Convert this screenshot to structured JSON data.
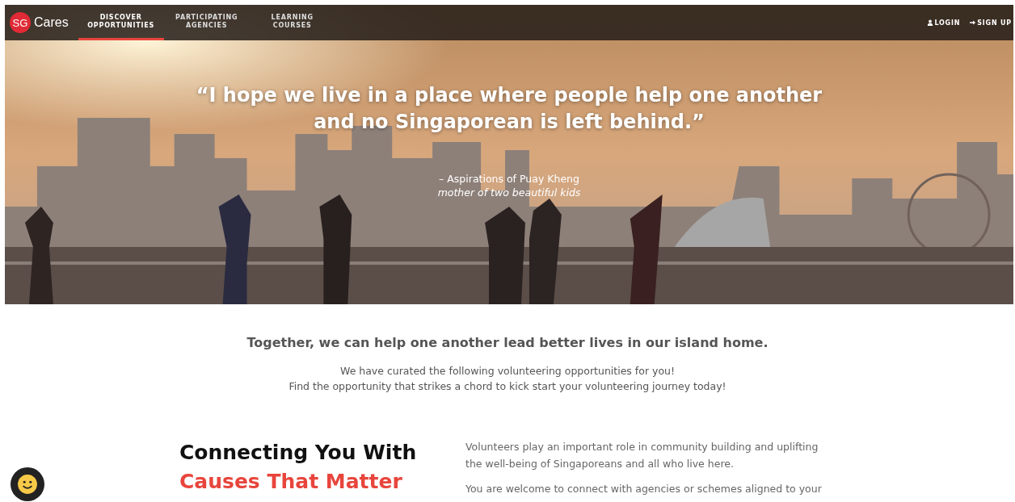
{
  "navbar": {
    "logo": {
      "badge": "SG",
      "name": "Cares"
    },
    "items": [
      {
        "label": "DISCOVER OPPORTUNITIES",
        "selected": true
      },
      {
        "label": "PARTICIPATING AGENCIES",
        "selected": false
      },
      {
        "label": "LEARNING COURSES",
        "selected": false
      }
    ],
    "account": [
      {
        "label": "LOGIN",
        "kind": "login"
      },
      {
        "label": "SIGN UP",
        "kind": "signup"
      }
    ]
  },
  "hero": {
    "quote_line_1": "“I hope we live in a place where people help one another",
    "quote_line_2": "and no Singaporean is left behind.”",
    "attribution": "– Aspirations of Puay Kheng",
    "caption": "mother of two beautiful kids"
  },
  "intro": {
    "heading": "Together, we can help one another lead better lives in our island home.",
    "lines": [
      "We have curated the following volunteering opportunities for you!",
      "Find the opportunity that strikes a chord to kick start your volunteering journey today!"
    ]
  },
  "connect": {
    "title_line_1": "Connecting You With",
    "title_line_2": "Causes That Matter",
    "paragraphs": [
      "Volunteers play an important role in community building and uplifting the well-being of Singaporeans and all who live here.",
      "You are welcome to connect with agencies or schemes aligned to your"
    ]
  }
}
